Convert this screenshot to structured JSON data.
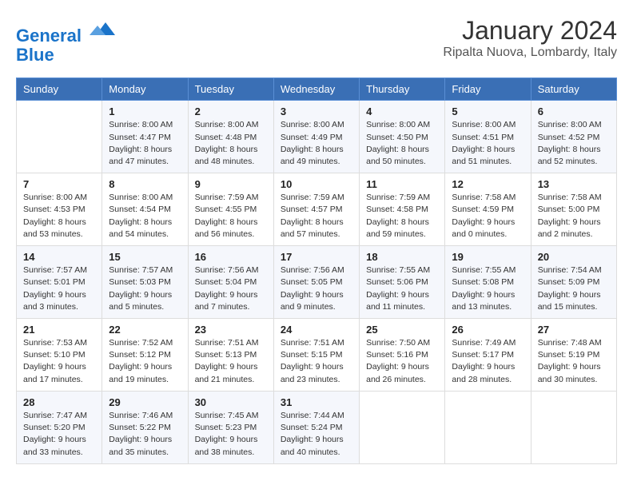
{
  "logo": {
    "line1": "General",
    "line2": "Blue"
  },
  "title": "January 2024",
  "subtitle": "Ripalta Nuova, Lombardy, Italy",
  "weekdays": [
    "Sunday",
    "Monday",
    "Tuesday",
    "Wednesday",
    "Thursday",
    "Friday",
    "Saturday"
  ],
  "weeks": [
    [
      {
        "day": "",
        "sunrise": "",
        "sunset": "",
        "daylight": ""
      },
      {
        "day": "1",
        "sunrise": "Sunrise: 8:00 AM",
        "sunset": "Sunset: 4:47 PM",
        "daylight": "Daylight: 8 hours and 47 minutes."
      },
      {
        "day": "2",
        "sunrise": "Sunrise: 8:00 AM",
        "sunset": "Sunset: 4:48 PM",
        "daylight": "Daylight: 8 hours and 48 minutes."
      },
      {
        "day": "3",
        "sunrise": "Sunrise: 8:00 AM",
        "sunset": "Sunset: 4:49 PM",
        "daylight": "Daylight: 8 hours and 49 minutes."
      },
      {
        "day": "4",
        "sunrise": "Sunrise: 8:00 AM",
        "sunset": "Sunset: 4:50 PM",
        "daylight": "Daylight: 8 hours and 50 minutes."
      },
      {
        "day": "5",
        "sunrise": "Sunrise: 8:00 AM",
        "sunset": "Sunset: 4:51 PM",
        "daylight": "Daylight: 8 hours and 51 minutes."
      },
      {
        "day": "6",
        "sunrise": "Sunrise: 8:00 AM",
        "sunset": "Sunset: 4:52 PM",
        "daylight": "Daylight: 8 hours and 52 minutes."
      }
    ],
    [
      {
        "day": "7",
        "sunrise": "Sunrise: 8:00 AM",
        "sunset": "Sunset: 4:53 PM",
        "daylight": "Daylight: 8 hours and 53 minutes."
      },
      {
        "day": "8",
        "sunrise": "Sunrise: 8:00 AM",
        "sunset": "Sunset: 4:54 PM",
        "daylight": "Daylight: 8 hours and 54 minutes."
      },
      {
        "day": "9",
        "sunrise": "Sunrise: 7:59 AM",
        "sunset": "Sunset: 4:55 PM",
        "daylight": "Daylight: 8 hours and 56 minutes."
      },
      {
        "day": "10",
        "sunrise": "Sunrise: 7:59 AM",
        "sunset": "Sunset: 4:57 PM",
        "daylight": "Daylight: 8 hours and 57 minutes."
      },
      {
        "day": "11",
        "sunrise": "Sunrise: 7:59 AM",
        "sunset": "Sunset: 4:58 PM",
        "daylight": "Daylight: 8 hours and 59 minutes."
      },
      {
        "day": "12",
        "sunrise": "Sunrise: 7:58 AM",
        "sunset": "Sunset: 4:59 PM",
        "daylight": "Daylight: 9 hours and 0 minutes."
      },
      {
        "day": "13",
        "sunrise": "Sunrise: 7:58 AM",
        "sunset": "Sunset: 5:00 PM",
        "daylight": "Daylight: 9 hours and 2 minutes."
      }
    ],
    [
      {
        "day": "14",
        "sunrise": "Sunrise: 7:57 AM",
        "sunset": "Sunset: 5:01 PM",
        "daylight": "Daylight: 9 hours and 3 minutes."
      },
      {
        "day": "15",
        "sunrise": "Sunrise: 7:57 AM",
        "sunset": "Sunset: 5:03 PM",
        "daylight": "Daylight: 9 hours and 5 minutes."
      },
      {
        "day": "16",
        "sunrise": "Sunrise: 7:56 AM",
        "sunset": "Sunset: 5:04 PM",
        "daylight": "Daylight: 9 hours and 7 minutes."
      },
      {
        "day": "17",
        "sunrise": "Sunrise: 7:56 AM",
        "sunset": "Sunset: 5:05 PM",
        "daylight": "Daylight: 9 hours and 9 minutes."
      },
      {
        "day": "18",
        "sunrise": "Sunrise: 7:55 AM",
        "sunset": "Sunset: 5:06 PM",
        "daylight": "Daylight: 9 hours and 11 minutes."
      },
      {
        "day": "19",
        "sunrise": "Sunrise: 7:55 AM",
        "sunset": "Sunset: 5:08 PM",
        "daylight": "Daylight: 9 hours and 13 minutes."
      },
      {
        "day": "20",
        "sunrise": "Sunrise: 7:54 AM",
        "sunset": "Sunset: 5:09 PM",
        "daylight": "Daylight: 9 hours and 15 minutes."
      }
    ],
    [
      {
        "day": "21",
        "sunrise": "Sunrise: 7:53 AM",
        "sunset": "Sunset: 5:10 PM",
        "daylight": "Daylight: 9 hours and 17 minutes."
      },
      {
        "day": "22",
        "sunrise": "Sunrise: 7:52 AM",
        "sunset": "Sunset: 5:12 PM",
        "daylight": "Daylight: 9 hours and 19 minutes."
      },
      {
        "day": "23",
        "sunrise": "Sunrise: 7:51 AM",
        "sunset": "Sunset: 5:13 PM",
        "daylight": "Daylight: 9 hours and 21 minutes."
      },
      {
        "day": "24",
        "sunrise": "Sunrise: 7:51 AM",
        "sunset": "Sunset: 5:15 PM",
        "daylight": "Daylight: 9 hours and 23 minutes."
      },
      {
        "day": "25",
        "sunrise": "Sunrise: 7:50 AM",
        "sunset": "Sunset: 5:16 PM",
        "daylight": "Daylight: 9 hours and 26 minutes."
      },
      {
        "day": "26",
        "sunrise": "Sunrise: 7:49 AM",
        "sunset": "Sunset: 5:17 PM",
        "daylight": "Daylight: 9 hours and 28 minutes."
      },
      {
        "day": "27",
        "sunrise": "Sunrise: 7:48 AM",
        "sunset": "Sunset: 5:19 PM",
        "daylight": "Daylight: 9 hours and 30 minutes."
      }
    ],
    [
      {
        "day": "28",
        "sunrise": "Sunrise: 7:47 AM",
        "sunset": "Sunset: 5:20 PM",
        "daylight": "Daylight: 9 hours and 33 minutes."
      },
      {
        "day": "29",
        "sunrise": "Sunrise: 7:46 AM",
        "sunset": "Sunset: 5:22 PM",
        "daylight": "Daylight: 9 hours and 35 minutes."
      },
      {
        "day": "30",
        "sunrise": "Sunrise: 7:45 AM",
        "sunset": "Sunset: 5:23 PM",
        "daylight": "Daylight: 9 hours and 38 minutes."
      },
      {
        "day": "31",
        "sunrise": "Sunrise: 7:44 AM",
        "sunset": "Sunset: 5:24 PM",
        "daylight": "Daylight: 9 hours and 40 minutes."
      },
      {
        "day": "",
        "sunrise": "",
        "sunset": "",
        "daylight": ""
      },
      {
        "day": "",
        "sunrise": "",
        "sunset": "",
        "daylight": ""
      },
      {
        "day": "",
        "sunrise": "",
        "sunset": "",
        "daylight": ""
      }
    ]
  ]
}
